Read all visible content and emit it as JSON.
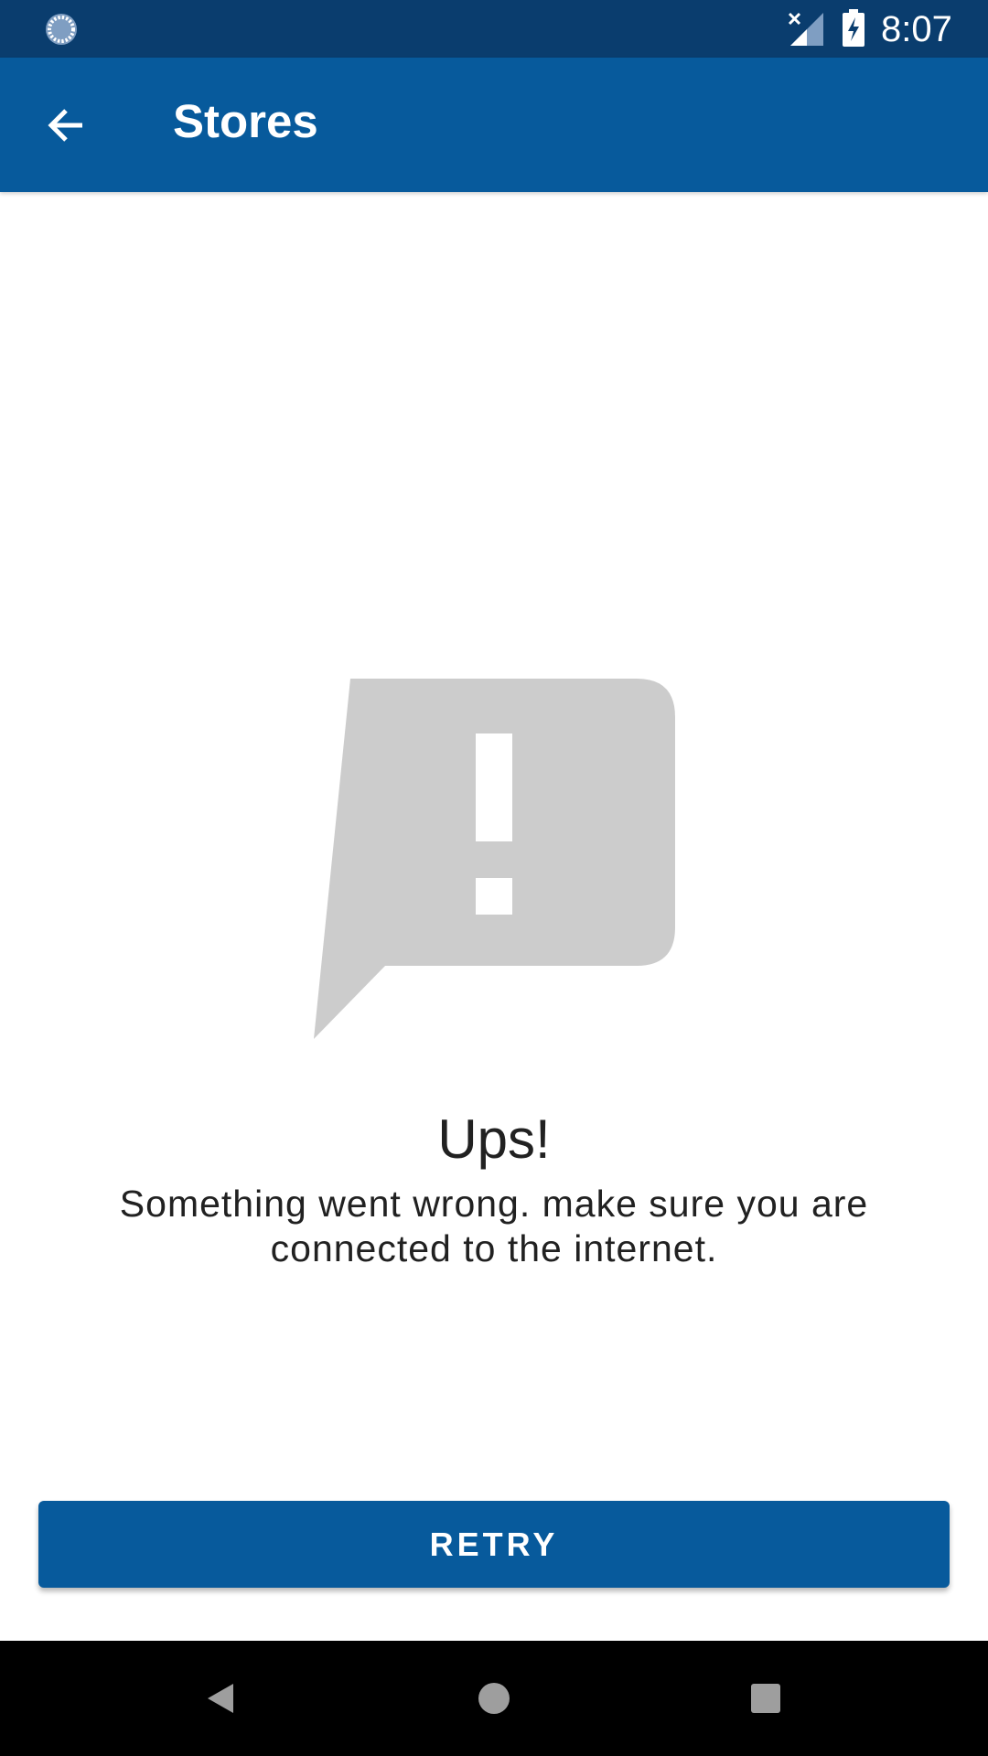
{
  "status_bar": {
    "time": "8:07",
    "icons": [
      "sync-icon",
      "signal-no-data-icon",
      "battery-charging-icon"
    ]
  },
  "app_bar": {
    "title": "Stores",
    "back_icon": "arrow-back-icon"
  },
  "error": {
    "icon": "feedback-exclamation-icon",
    "title": "Ups!",
    "message": "Something went wrong. make sure you are connected to the internet."
  },
  "actions": {
    "retry_label": "RETRY"
  },
  "nav_bar": {
    "icons": [
      "back-triangle-icon",
      "home-circle-icon",
      "recents-square-icon"
    ]
  },
  "colors": {
    "status_bar": "#0a3d6e",
    "app_bar": "#075a9c",
    "button": "#075a9c",
    "illustration": "#cccccc",
    "text": "#212121"
  }
}
